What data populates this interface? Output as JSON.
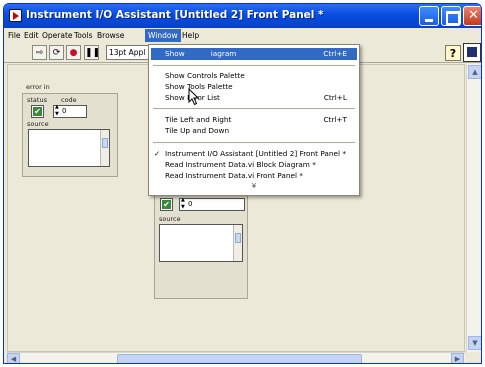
{
  "window": {
    "title": "Instrument I/O Assistant [Untitled 2] Front Panel *"
  },
  "menubar": [
    "File",
    "Edit",
    "Operate",
    "Tools",
    "Browse",
    "Window",
    "Help"
  ],
  "toolbar": {
    "font_label": "13pt Appl",
    "help_glyph": "?"
  },
  "front_panel": {
    "error_in": {
      "label": "error in",
      "status_label": "status",
      "code_label": "code",
      "code_value": "0",
      "source_label": "source"
    },
    "error_out": {
      "code_value": "0",
      "source_label": "source"
    }
  },
  "window_menu": {
    "items": [
      {
        "label": "Show Block Diagram",
        "visible_label": "Show",
        "shortcut": "Ctrl+E",
        "highlighted": true
      },
      {
        "label": "Show Controls Palette",
        "shortcut": ""
      },
      {
        "label": "Show Tools Palette",
        "shortcut": ""
      },
      {
        "label": "Show Error List",
        "shortcut": "Ctrl+L"
      },
      {
        "label": "Tile Left and Right",
        "shortcut": "Ctrl+T"
      },
      {
        "label": "Tile Up and Down",
        "shortcut": ""
      },
      {
        "label": "Instrument I/O Assistant [Untitled 2] Front Panel *",
        "shortcut": "",
        "checked": true
      },
      {
        "label": "Read Instrument Data.vi Block Diagram *",
        "shortcut": ""
      },
      {
        "label": "Read Instrument Data.vi Front Panel *",
        "shortcut": ""
      }
    ],
    "highlight_visible_tail": "iagram",
    "more_glyph": "¥"
  },
  "colors": {
    "titlebar": "#0a4de0",
    "menu_highlight": "#316ac5",
    "face": "#ece9d8",
    "status_ok": "#3a8a3a"
  }
}
